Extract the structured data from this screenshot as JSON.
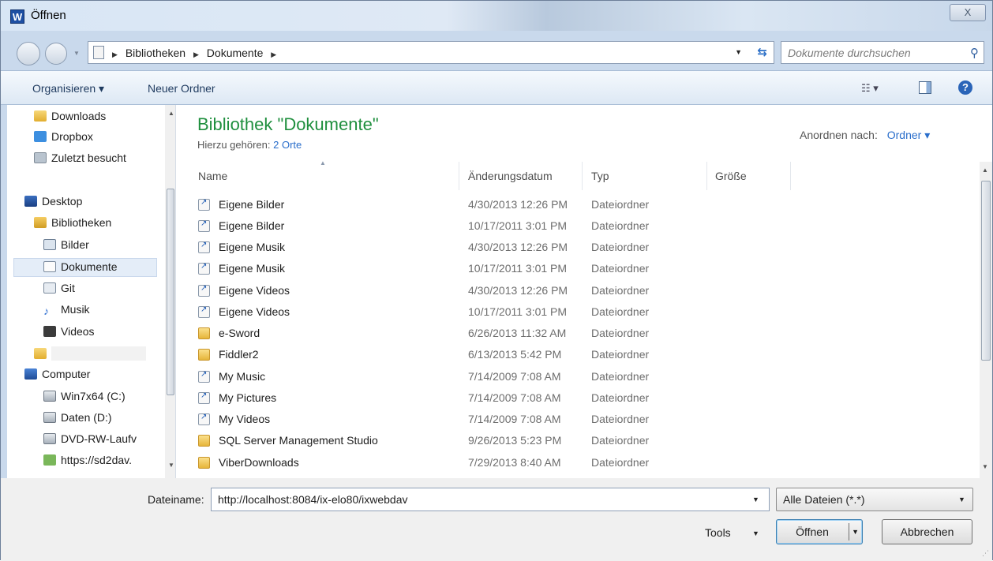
{
  "window": {
    "app_icon": "W",
    "title": "Öffnen",
    "close": "X"
  },
  "navigation": {
    "breadcrumbs": [
      "Bibliotheken",
      "Dokumente"
    ],
    "search_placeholder": "Dokumente durchsuchen"
  },
  "toolbar": {
    "organize": "Organisieren ▾",
    "new_folder": "Neuer Ordner",
    "help": "?"
  },
  "sidebar": {
    "items": [
      {
        "label": "Downloads",
        "icon": "downloads-folder-icon"
      },
      {
        "label": "Dropbox",
        "icon": "dropbox-icon"
      },
      {
        "label": "Zuletzt besucht",
        "icon": "recent-places-icon"
      },
      {
        "label": "Desktop",
        "icon": "desktop-icon"
      },
      {
        "label": "Bibliotheken",
        "icon": "libraries-icon"
      },
      {
        "label": "Bilder",
        "icon": "pictures-library-icon"
      },
      {
        "label": "Dokumente",
        "icon": "documents-library-icon",
        "selected": true
      },
      {
        "label": "Git",
        "icon": "git-library-icon"
      },
      {
        "label": "Musik",
        "icon": "music-library-icon"
      },
      {
        "label": "Videos",
        "icon": "videos-library-icon"
      },
      {
        "label": "",
        "icon": "user-folder-icon"
      },
      {
        "label": "Computer",
        "icon": "computer-icon"
      },
      {
        "label": "Win7x64 (C:)",
        "icon": "windows-drive-icon"
      },
      {
        "label": "Daten (D:)",
        "icon": "hard-drive-icon"
      },
      {
        "label": "DVD-RW-Laufv",
        "icon": "dvd-drive-icon"
      },
      {
        "label": "https://sd2dav.",
        "icon": "network-drive-icon"
      }
    ]
  },
  "content": {
    "title": "Bibliothek \"Dokumente\"",
    "includes_label": "Hierzu gehören:",
    "includes_link": "2 Orte",
    "arrange_label": "Anordnen nach:",
    "arrange_value": "Ordner ▾",
    "columns": {
      "name": "Name",
      "date": "Änderungsdatum",
      "type": "Typ",
      "size": "Größe"
    },
    "files": [
      {
        "name": "Eigene Bilder",
        "date": "4/30/2013 12:26 PM",
        "type": "Dateiordner",
        "icon": "shortcut-icon"
      },
      {
        "name": "Eigene Bilder",
        "date": "10/17/2011 3:01 PM",
        "type": "Dateiordner",
        "icon": "shortcut-icon"
      },
      {
        "name": "Eigene Musik",
        "date": "4/30/2013 12:26 PM",
        "type": "Dateiordner",
        "icon": "shortcut-icon"
      },
      {
        "name": "Eigene Musik",
        "date": "10/17/2011 3:01 PM",
        "type": "Dateiordner",
        "icon": "shortcut-icon"
      },
      {
        "name": "Eigene Videos",
        "date": "4/30/2013 12:26 PM",
        "type": "Dateiordner",
        "icon": "shortcut-icon"
      },
      {
        "name": "Eigene Videos",
        "date": "10/17/2011 3:01 PM",
        "type": "Dateiordner",
        "icon": "shortcut-icon"
      },
      {
        "name": "e-Sword",
        "date": "6/26/2013 11:32 AM",
        "type": "Dateiordner",
        "icon": "folder-icon"
      },
      {
        "name": "Fiddler2",
        "date": "6/13/2013 5:42 PM",
        "type": "Dateiordner",
        "icon": "folder-icon"
      },
      {
        "name": "My Music",
        "date": "7/14/2009 7:08 AM",
        "type": "Dateiordner",
        "icon": "shortcut-icon"
      },
      {
        "name": "My Pictures",
        "date": "7/14/2009 7:08 AM",
        "type": "Dateiordner",
        "icon": "shortcut-icon"
      },
      {
        "name": "My Videos",
        "date": "7/14/2009 7:08 AM",
        "type": "Dateiordner",
        "icon": "shortcut-icon"
      },
      {
        "name": "SQL Server Management Studio",
        "date": "9/26/2013 5:23 PM",
        "type": "Dateiordner",
        "icon": "folder-icon"
      },
      {
        "name": "ViberDownloads",
        "date": "7/29/2013 8:40 AM",
        "type": "Dateiordner",
        "icon": "folder-icon"
      }
    ]
  },
  "footer": {
    "filename_label": "Dateiname:",
    "filename_value": "http://localhost:8084/ix-elo80/ixwebdav",
    "filter_value": "Alle Dateien (*.*)",
    "tools_label": "Tools",
    "open_label": "Öffnen",
    "cancel_label": "Abbrechen"
  },
  "colors": {
    "accent_green": "#1f8f3e",
    "link_blue": "#2a6ecb"
  }
}
